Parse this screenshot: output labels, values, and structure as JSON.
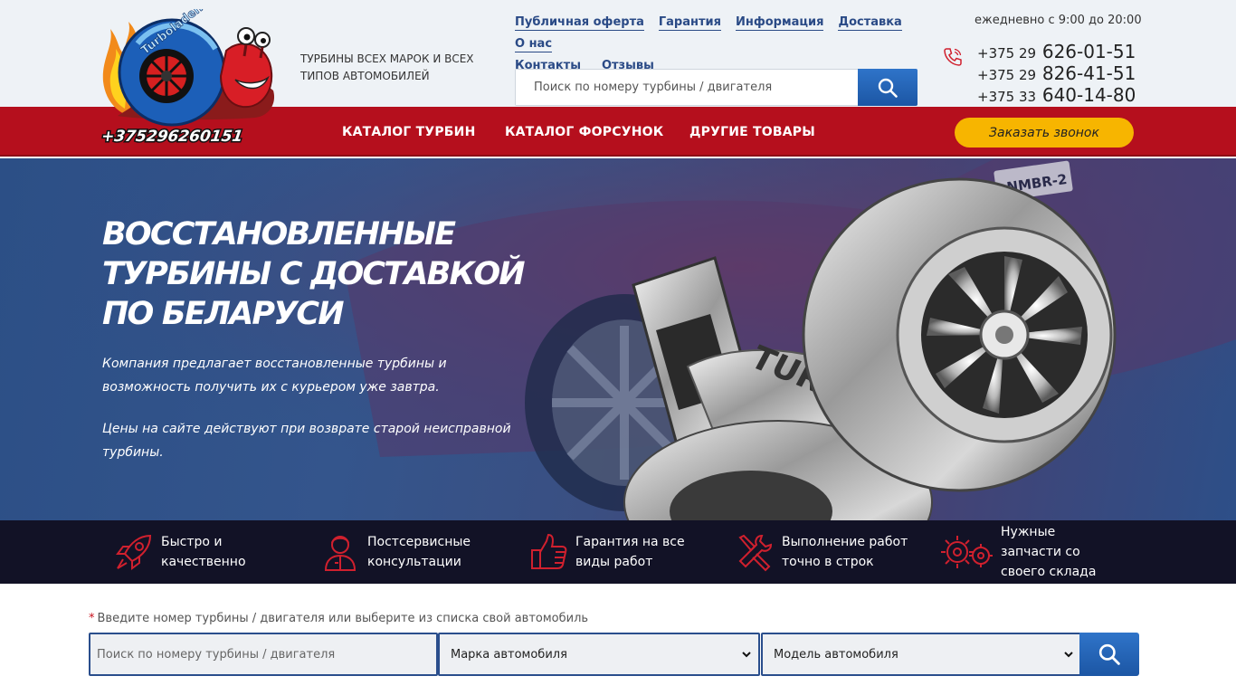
{
  "header": {
    "logo_text": "Turbolader.by",
    "logo_phone": "+375296260151",
    "tagline": "ТУРБИНЫ ВСЕХ МАРОК И ВСЕХ ТИПОВ АВТОМОБИЛЕЙ",
    "nav_links": [
      "Публичная оферта",
      "Гарантия",
      "Информация",
      "Доставка",
      "О нас",
      "Контакты",
      "Отзывы"
    ],
    "search_placeholder": "Поиск по номеру турбины / двигателя",
    "hours": "ежедневно с 9:00 до 20:00",
    "phones": [
      {
        "code": "+375 29",
        "number": "626-01-51"
      },
      {
        "code": "+375 29",
        "number": "826-41-51"
      },
      {
        "code": "+375 33",
        "number": "640-14-80"
      }
    ]
  },
  "menu": {
    "items": [
      "КАТАЛОГ ТУРБИН",
      "КАТАЛОГ ФОРСУНОК",
      "ДРУГИЕ ТОВАРЫ"
    ],
    "callback_label": "Заказать звонок"
  },
  "hero": {
    "title": "ВОССТАНОВЛЕННЫЕ ТУРБИНЫ С ДОСТАВКОЙ ПО БЕЛАРУСИ",
    "paragraph1": "Компания предлагает восстановленные турбины и возможность получить их с курьером уже завтра.",
    "paragraph2": "Цены на сайте действуют при возврате старой неисправной турбины.",
    "image_text": "TURBO",
    "plate_text": "NMBR-2"
  },
  "features": [
    {
      "icon": "rocket-icon",
      "text": "Быстро и качественно"
    },
    {
      "icon": "consultant-icon",
      "text": "Постсервисные консультации"
    },
    {
      "icon": "thumbs-up-icon",
      "text": "Гарантия на все виды работ"
    },
    {
      "icon": "tools-icon",
      "text": "Выполнение работ точно в строк"
    },
    {
      "icon": "gears-icon",
      "text": "Нужные запчасти со своего склада"
    }
  ],
  "search_form": {
    "hint": "Введите номер турбины / двигателя или выберите из списка свой автомобиль",
    "required_mark": "*",
    "search_placeholder": "Поиск по номеру турбины / двигателя",
    "make_select": "Марка автомобиля",
    "model_select": "Модель автомобиля"
  },
  "colors": {
    "menu_red": "#b50f1d",
    "accent_blue": "#1c56a4",
    "callback_yellow": "#f7b500",
    "features_bg": "#121226",
    "link_blue": "#2a4a86"
  }
}
